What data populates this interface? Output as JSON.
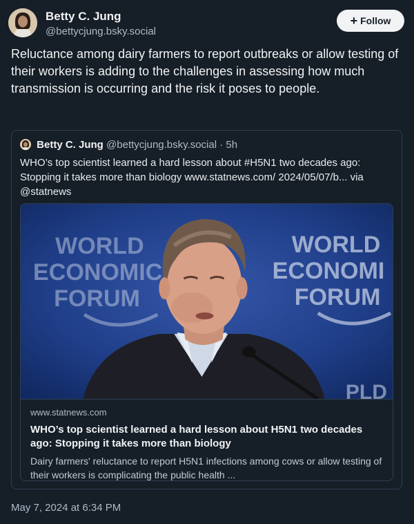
{
  "author": {
    "display_name": "Betty C. Jung",
    "handle": "@bettycjung.bsky.social"
  },
  "follow_button": {
    "label": "Follow",
    "icon": "plus-icon"
  },
  "post": {
    "text": "Reluctance among dairy farmers to report outbreaks or allow testing of their workers is adding to the challenges in assessing how much transmission is occurring and the risk it poses to people.",
    "timestamp": "May 7, 2024 at 6:34 PM"
  },
  "quote": {
    "display_name": "Betty C. Jung",
    "handle": "@bettycjung.bsky.social",
    "age": "· 5h",
    "text": "WHO’s top scientist learned a hard lesson about #H5N1 two decades ago: Stopping it takes more than biology www.statnews.com/ 2024/05/07/b... via @statnews",
    "card": {
      "domain": "www.statnews.com",
      "title": "WHO’s top scientist learned a hard lesson about H5N1 two decades ago: Stopping it takes more than biology",
      "description": "Dairy farmers' reluctance to report H5N1 infections among cows or allow testing of their workers is complicating the public health ...",
      "image_banner_left": [
        "WORLD",
        "ECONOMIC",
        "FORUM"
      ],
      "image_banner_right": [
        "WORLD",
        "ECONOMI",
        "FORUM"
      ]
    }
  },
  "colors": {
    "background": "#161e27",
    "border": "#2e4052",
    "muted_text": "#aebbc9",
    "primary_text": "#f1f3f5"
  }
}
